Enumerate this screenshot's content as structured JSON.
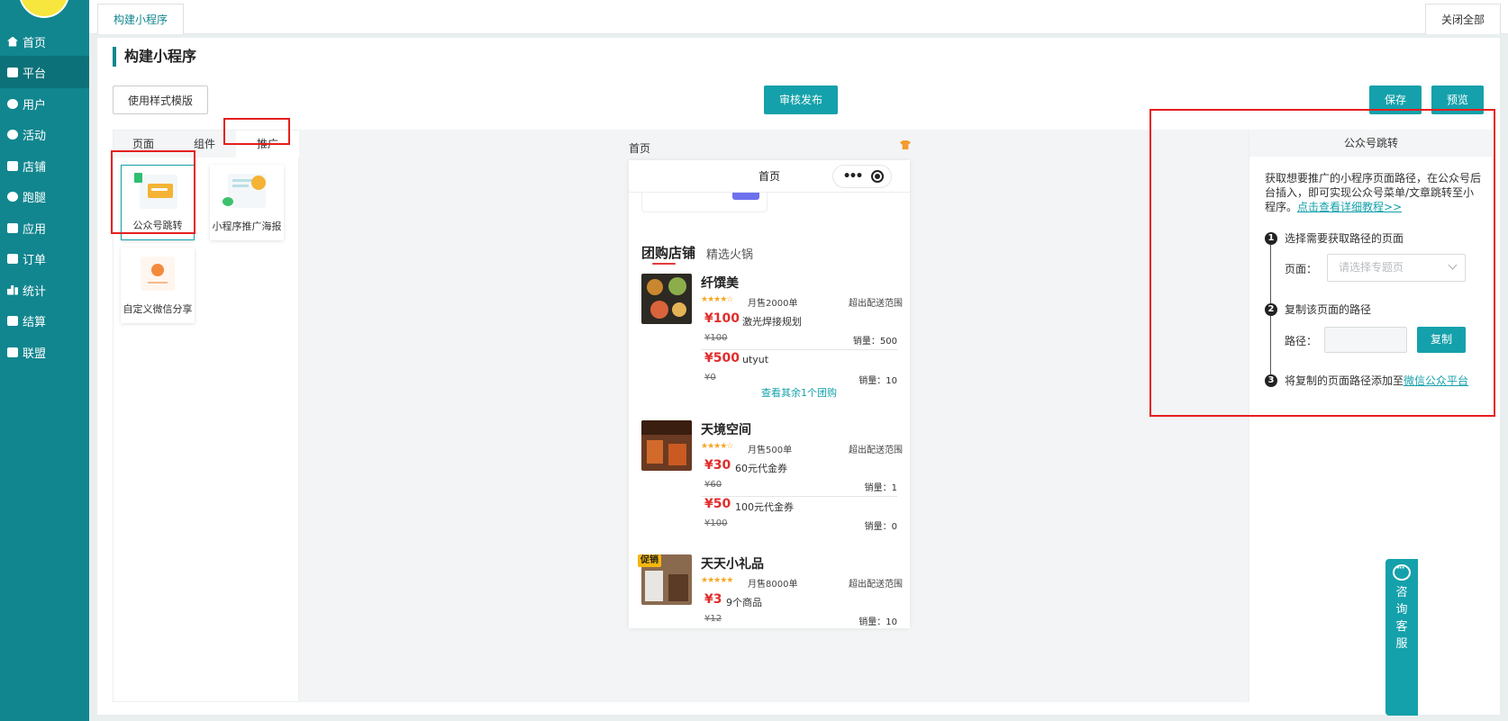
{
  "sidebar": {
    "items": [
      {
        "label": "首页",
        "icon": "home-icon",
        "active": false
      },
      {
        "label": "平台",
        "icon": "monitor-icon",
        "active": true
      },
      {
        "label": "用户",
        "icon": "user-icon",
        "active": false
      },
      {
        "label": "活动",
        "icon": "chat-bubble-icon",
        "active": false
      },
      {
        "label": "店铺",
        "icon": "store-icon",
        "active": false
      },
      {
        "label": "跑腿",
        "icon": "bike-icon",
        "active": false
      },
      {
        "label": "应用",
        "icon": "app-icon",
        "active": false
      },
      {
        "label": "订单",
        "icon": "order-icon",
        "active": false
      },
      {
        "label": "统计",
        "icon": "bar-chart-icon",
        "active": false
      },
      {
        "label": "结算",
        "icon": "settle-icon",
        "active": false
      },
      {
        "label": "联盟",
        "icon": "alliance-icon",
        "active": false
      }
    ]
  },
  "tabbar": {
    "active_tab": "构建小程序",
    "close_all": "关闭全部"
  },
  "page": {
    "title": "构建小程序"
  },
  "toolbar": {
    "template_btn": "使用样式模版",
    "publish_btn": "审核发布",
    "save_btn": "保存",
    "preview_btn": "预览"
  },
  "left_panel": {
    "tabs": [
      "页面",
      "组件",
      "推广"
    ],
    "active_tab": "推广",
    "components": [
      {
        "label": "公众号跳转",
        "selected": true
      },
      {
        "label": "小程序推广海报",
        "selected": false
      },
      {
        "label": "自定义微信分享",
        "selected": false
      }
    ]
  },
  "preview": {
    "page_label": "首页",
    "phone_title": "首页",
    "capsule_dots": "•••",
    "section_tab_active": "团购店铺",
    "section_tab_other": "精选火锅",
    "shops": [
      {
        "name": "纤馔美",
        "stars": "★★★★☆",
        "sales": "月售2000单",
        "delivery": "超出配送范围",
        "badge": "",
        "deals": [
          {
            "price": "¥100",
            "name": "激光焊接规划",
            "orig": "¥100",
            "sold": "销量：500"
          },
          {
            "price": "¥500",
            "name": "utyut",
            "orig": "¥0",
            "sold": "销量：10"
          }
        ],
        "more": "查看其余1个团购"
      },
      {
        "name": "天境空间",
        "stars": "★★★★☆",
        "sales": "月售500单",
        "delivery": "超出配送范围",
        "badge": "",
        "deals": [
          {
            "price": "¥30",
            "name": "60元代金券",
            "orig": "¥60",
            "sold": "销量：1"
          },
          {
            "price": "¥50",
            "name": "100元代金券",
            "orig": "¥100",
            "sold": "销量：0"
          }
        ],
        "more": ""
      },
      {
        "name": "天天小礼品",
        "stars": "★★★★★",
        "sales": "月售8000单",
        "delivery": "超出配送范围",
        "badge": "促销",
        "deals": [
          {
            "price": "¥3",
            "name": "9个商品",
            "orig": "¥12",
            "sold": "销量：10"
          }
        ],
        "more": ""
      }
    ]
  },
  "right_panel": {
    "title": "公众号跳转",
    "desc": "获取想要推广的小程序页面路径，在公众号后台插入，即可实现公众号菜单/文章跳转至小程序。",
    "desc_link": "点击查看详细教程>>",
    "step1": "选择需要获取路径的页面",
    "page_label": "页面：",
    "page_placeholder": "请选择专题页",
    "step2": "复制该页面的路径",
    "path_label": "路径：",
    "copy_btn": "复制",
    "step3": "将复制的页面路径添加至",
    "step3_link": "微信公众平台"
  },
  "chat_widget": {
    "label": "咨询客服"
  },
  "colors": {
    "sidebar": "#11868f",
    "accent": "#14a1ab",
    "highlight": "#e61e1e",
    "price": "#e12d2d"
  }
}
